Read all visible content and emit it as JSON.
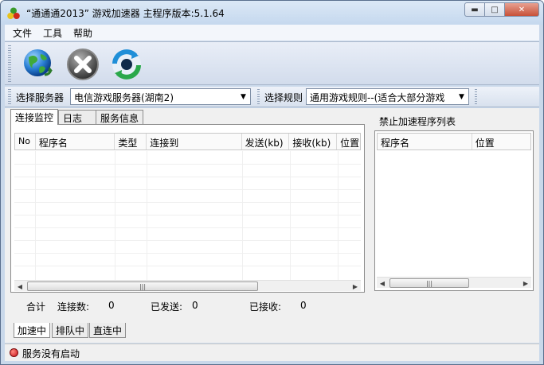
{
  "window": {
    "title": "“通通通2013” 游戏加速器  主程序版本:5.1.64",
    "app_icon": "tri-circle-icon"
  },
  "menu": {
    "items": [
      {
        "label": "文件"
      },
      {
        "label": "工具"
      },
      {
        "label": "帮助"
      }
    ]
  },
  "toolbar": {
    "buttons": [
      {
        "icon": "globe-connect-icon"
      },
      {
        "icon": "stop-x-icon"
      },
      {
        "icon": "refresh-switch-icon"
      }
    ]
  },
  "selectors": {
    "server_label": "选择服务器",
    "server_value": "电信游戏服务器(湖南2)",
    "rule_label": "选择规则",
    "rule_value": "通用游戏规则--(适合大部分游戏"
  },
  "tabs": {
    "top": [
      {
        "label": "连接监控"
      },
      {
        "label": "日志"
      },
      {
        "label": "服务信息"
      }
    ],
    "bottom": [
      {
        "label": "加速中"
      },
      {
        "label": "排队中"
      },
      {
        "label": "直连中"
      }
    ]
  },
  "connections_table": {
    "columns": [
      "No",
      "程序名",
      "类型",
      "连接到",
      "发送(kb)",
      "接收(kb)",
      "位置"
    ],
    "rows": []
  },
  "stats": {
    "total_label": "合计",
    "connections_label": "连接数:",
    "connections_value": "0",
    "sent_label": "已发送:",
    "sent_value": "0",
    "received_label": "已接收:",
    "received_value": "0"
  },
  "blocked_list": {
    "title": "禁止加速程序列表",
    "columns": [
      "程序名",
      "位置"
    ],
    "rows": []
  },
  "status": {
    "text": "服务没有启动",
    "color": "#d01010"
  }
}
